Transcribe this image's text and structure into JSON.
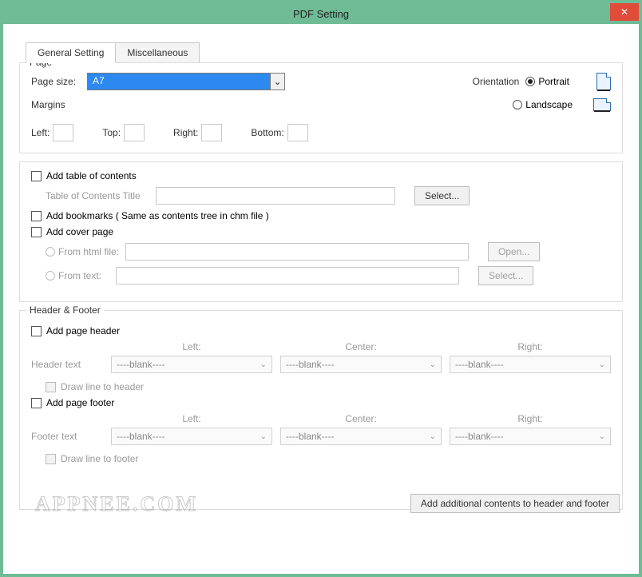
{
  "window": {
    "title": "PDF Setting",
    "close_glyph": "✕"
  },
  "tabs": {
    "general": "General Setting",
    "misc": "Miscellaneous"
  },
  "page": {
    "legend": "Page",
    "size_label": "Page size:",
    "size_value": "A7",
    "orientation_label": "Orientation",
    "portrait": "Portrait",
    "landscape": "Landscape",
    "margins_label": "Margins",
    "left": "Left:",
    "top": "Top:",
    "right": "Right:",
    "bottom": "Bottom:"
  },
  "toc": {
    "add_label": "Add table of contents",
    "title_label": "Table of Contents Title",
    "select_btn": "Select..."
  },
  "bookmarks": {
    "label": "Add  bookmarks ( Same as contents tree in chm file )"
  },
  "cover": {
    "label": "Add cover page",
    "from_html": "From html file:",
    "from_text": "From  text:",
    "open_btn": "Open...",
    "select_btn": "Select..."
  },
  "hf": {
    "legend": "Header & Footer",
    "add_header": "Add page header",
    "add_footer": "Add page footer",
    "left": "Left:",
    "center": "Center:",
    "right": "Right:",
    "header_text": "Header text",
    "footer_text": "Footer text",
    "blank": "----blank----",
    "draw_header": "Draw line to header",
    "draw_footer": "Draw line to footer",
    "additional_btn": "Add additional contents to header and footer"
  },
  "watermark": "APPNEE.COM",
  "glyphs": {
    "caret": "⌄",
    "caret_small": "⌄"
  }
}
